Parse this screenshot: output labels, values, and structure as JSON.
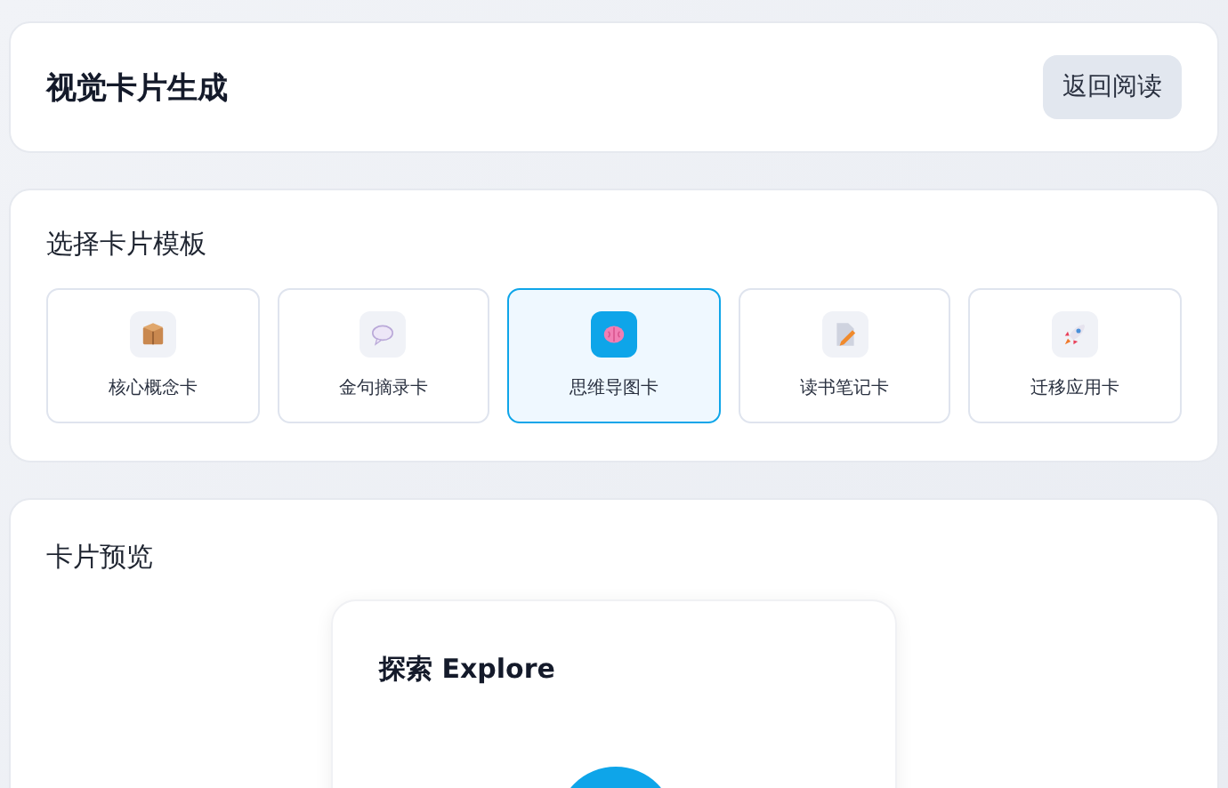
{
  "header": {
    "title": "视觉卡片生成",
    "back_button": "返回阅读"
  },
  "templates": {
    "title": "选择卡片模板",
    "items": [
      {
        "label": "核心概念卡",
        "selected": false
      },
      {
        "label": "金句摘录卡",
        "selected": false
      },
      {
        "label": "思维导图卡",
        "selected": true
      },
      {
        "label": "读书笔记卡",
        "selected": false
      },
      {
        "label": "迁移应用卡",
        "selected": false
      }
    ]
  },
  "preview": {
    "title": "卡片预览",
    "card_title": "探索 Explore"
  }
}
